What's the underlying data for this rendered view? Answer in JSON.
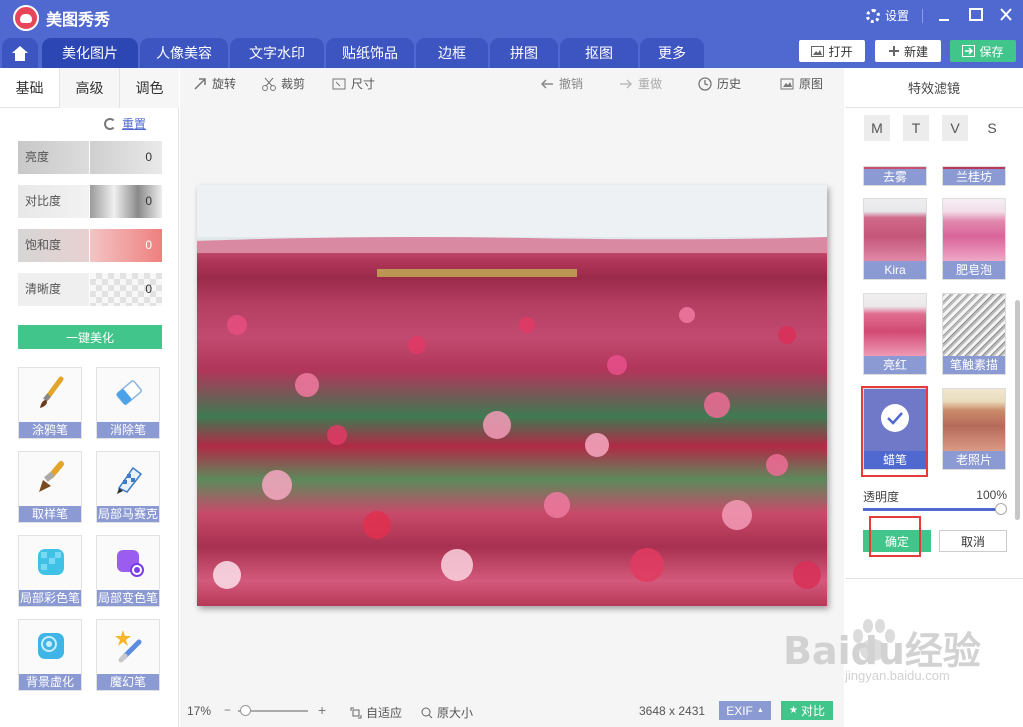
{
  "app": {
    "title": "美图秀秀",
    "settings": "设置"
  },
  "tabs": [
    {
      "label": "美化图片"
    },
    {
      "label": "人像美容"
    },
    {
      "label": "文字水印"
    },
    {
      "label": "贴纸饰品"
    },
    {
      "label": "边框"
    },
    {
      "label": "拼图"
    },
    {
      "label": "抠图"
    },
    {
      "label": "更多"
    }
  ],
  "top_actions": {
    "open": "打开",
    "new": "新建",
    "save": "保存"
  },
  "left": {
    "tabs": [
      "基础",
      "高级",
      "调色"
    ],
    "reset": "重置",
    "sliders": [
      {
        "label": "亮度",
        "value": "0"
      },
      {
        "label": "对比度",
        "value": "0"
      },
      {
        "label": "饱和度",
        "value": "0"
      },
      {
        "label": "清晰度",
        "value": "0"
      }
    ],
    "one_click": "一键美化",
    "tools": [
      {
        "label": "涂鸦笔",
        "icon": "paintbrush-icon"
      },
      {
        "label": "消除笔",
        "icon": "eraser-icon"
      },
      {
        "label": "取样笔",
        "icon": "sample-brush-icon"
      },
      {
        "label": "局部马赛克",
        "icon": "mosaic-pen-icon"
      },
      {
        "label": "局部彩色笔",
        "icon": "color-pen-icon"
      },
      {
        "label": "局部变色笔",
        "icon": "recolor-pen-icon"
      },
      {
        "label": "背景虚化",
        "icon": "blur-background-icon"
      },
      {
        "label": "魔幻笔",
        "icon": "magic-pen-icon"
      }
    ]
  },
  "toolbar": {
    "rotate": "旋转",
    "crop": "裁剪",
    "size": "尺寸",
    "undo": "撤销",
    "redo": "重做",
    "history": "历史",
    "original": "原图"
  },
  "status": {
    "zoom": "17%",
    "fit": "自适应",
    "actual": "原大小",
    "dimensions": "3648 x 2431",
    "exif": "EXIF",
    "compare": "对比"
  },
  "right": {
    "title": "特效滤镜",
    "letters": [
      "M",
      "T",
      "V",
      "S"
    ],
    "filters": [
      {
        "label": "去雾"
      },
      {
        "label": "兰桂坊"
      },
      {
        "label": "Kira"
      },
      {
        "label": "肥皂泡"
      },
      {
        "label": "亮红"
      },
      {
        "label": "笔触素描"
      },
      {
        "label": "蜡笔"
      },
      {
        "label": "老照片"
      }
    ],
    "opacity_label": "透明度",
    "opacity_value": "100%",
    "opacity_fraction": 1.0,
    "confirm": "确定",
    "cancel": "取消"
  },
  "watermark": {
    "brand": "Baidu经验",
    "url": "jingyan.baidu.com"
  },
  "colors": {
    "primary": "#4f69d1",
    "green": "#42c58b",
    "tab": "#3d55c0",
    "highlight": "#e53b3b"
  }
}
